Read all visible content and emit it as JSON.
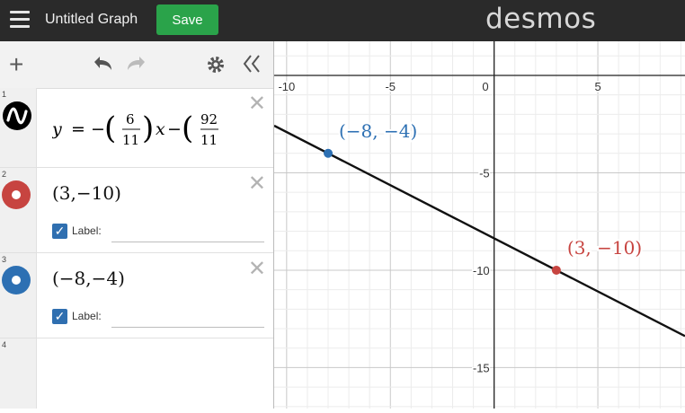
{
  "header": {
    "title": "Untitled Graph",
    "save_label": "Save",
    "logo": "desmos"
  },
  "toolbar": {
    "add_icon": "plus-icon",
    "undo_icon": "undo-icon",
    "redo_icon": "redo-icon",
    "settings_icon": "gear-icon",
    "collapse_icon": "double-chevron-left-icon"
  },
  "expressions": [
    {
      "number": "1",
      "type": "line",
      "text": "y = −(6/11)x − (92/11"
    },
    {
      "number": "2",
      "type": "point",
      "text": "(3,−10)",
      "color": "#c74440",
      "label_text": "Label:"
    },
    {
      "number": "3",
      "type": "point",
      "text": "(−8,−4)",
      "color": "#2d70b3",
      "label_text": "Label:"
    },
    {
      "number": "4",
      "type": "empty",
      "text": ""
    }
  ],
  "graph": {
    "x_ticks": [
      "-10",
      "-5",
      "0",
      "5"
    ],
    "y_ticks": [
      "-5",
      "-10",
      "-15"
    ],
    "points": [
      {
        "x": -8,
        "y": -4,
        "label": "(−8, −4)",
        "color": "#2d70b3"
      },
      {
        "x": 3,
        "y": -10,
        "label": "(3, −10)",
        "color": "#c74440"
      }
    ],
    "line": {
      "slope": -0.545454,
      "intercept": -8.363636,
      "color": "#111111"
    },
    "xrange": [
      -10.6,
      9.2
    ],
    "yrange": [
      -17.1,
      1.75
    ]
  }
}
